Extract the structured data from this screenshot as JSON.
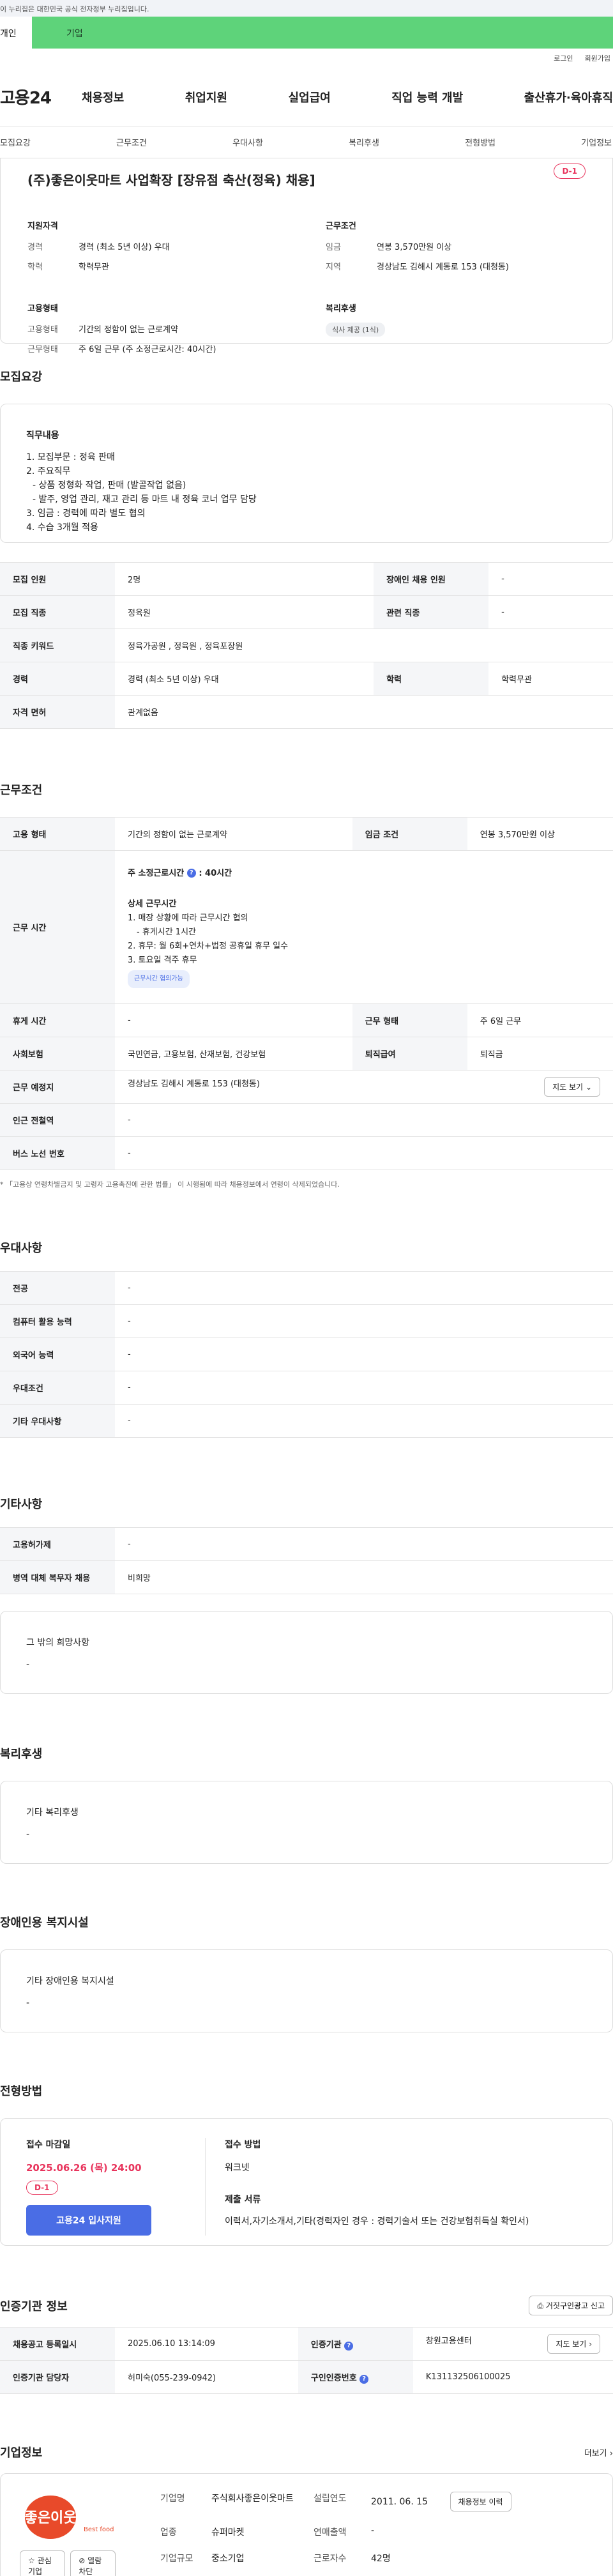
{
  "gov_notice": "이 누리집은 대한민국 공식 전자정부 누리집입니다.",
  "top_tabs": [
    "개인",
    "기업"
  ],
  "utility": [
    "로그인",
    "회원가입"
  ],
  "logo": "고용24",
  "gnb": [
    "채용정보",
    "취업지원",
    "실업급여",
    "직업 능력 개발",
    "출산휴가·육아휴직"
  ],
  "subtabs": [
    "모집요강",
    "근무조건",
    "우대사항",
    "복리후생",
    "전형방법",
    "기업정보"
  ],
  "summary": {
    "title": "(주)좋은이웃마트 사업확장 [장유점 축산(정육) 채용]",
    "dday": "D-1",
    "qual_title": "지원자격",
    "qual": [
      {
        "k": "경력",
        "v": "경력 (최소 5년 이상) 우대"
      },
      {
        "k": "학력",
        "v": "학력무관"
      }
    ],
    "cond_title": "근무조건",
    "cond": [
      {
        "k": "임금",
        "v": "연봉 3,570만원 이상"
      },
      {
        "k": "지역",
        "v": "경상남도 김해시 계동로 153 (대청동)"
      }
    ],
    "emp_title": "고용형태",
    "emp": [
      {
        "k": "고용형태",
        "v": "기간의 정함이 없는 근로계약"
      },
      {
        "k": "근무형태",
        "v": "주 6일 근무 (주 소정근로시간: 40시간)"
      }
    ],
    "welfare_title": "복리후생",
    "welfare_chip": "식사 제공 (1식)"
  },
  "recruit": {
    "title": "모집요강",
    "duty_title": "직무내용",
    "duty_lines": [
      "1. 모집부문 : 정육 판매",
      "2. 주요직무",
      "  - 상품 정형화 작업, 판매 (발골작업 없음)",
      "  - 발주, 영업 관리, 재고 관리 등 마트 내 정육 코너 업무 담당",
      "3. 임금 : 경력에 따라 별도 협의",
      "4. 수습 3개월 적용"
    ],
    "rows": [
      {
        "k1": "모집 인원",
        "v1": "2명",
        "k2": "장애인 채용 인원",
        "v2": "-"
      },
      {
        "k1": "모집 직종",
        "v1": "정육원",
        "k2": "관련 직종",
        "v2": "-"
      },
      {
        "k1": "직종 키워드",
        "v1": "정육가공원 , 정육원 , 정육포장원",
        "k2": "",
        "v2": ""
      },
      {
        "k1": "경력",
        "v1": "경력 (최소 5년 이상) 우대",
        "k2": "학력",
        "v2": "학력무관"
      },
      {
        "k1": "자격 면허",
        "v1": "관계없음",
        "k2": "",
        "v2": ""
      }
    ]
  },
  "workcond": {
    "title": "근무조건",
    "r1": {
      "k1": "고용 형태",
      "v1": "기간의 정함이 없는 근로계약",
      "k2": "임금 조건",
      "v2": "연봉 3,570만원 이상"
    },
    "hours_key": "근무 시간",
    "hours_main": "주 소정근로시간",
    "hours_val": ": 40시간",
    "hours_detail_title": "상세 근무시간",
    "hours_lines": [
      "1. 매장 상황에 따라 근무시간 협의",
      "   - 휴게시간 1시간",
      "2. 휴무: 월 6회+연차+법정 공휴일 휴무 일수",
      "3. 토요일 격주 휴무"
    ],
    "hours_chip": "근무시간 협의가능",
    "r2": {
      "k1": "휴게 시간",
      "v1": "-",
      "k2": "근무 형태",
      "v2": "주 6일 근무"
    },
    "r3": {
      "k1": "사회보험",
      "v1": "국민연금, 고용보험, 산재보험, 건강보험",
      "k2": "퇴직급여",
      "v2": "퇴직금"
    },
    "r4": {
      "k1": "근무 예정지",
      "v1": "경상남도 김해시 계동로 153 (대청동)",
      "btn": "지도 보기"
    },
    "r5": {
      "k1": "인근 전철역",
      "v1": "-"
    },
    "r6": {
      "k1": "버스 노선 번호",
      "v1": "-"
    },
    "notice": "* 「고용상 연령차별금지 및 고령자 고용촉진에 관한 법률」 이 시행됨에 따라 채용정보에서 연령이 삭제되었습니다."
  },
  "pref": {
    "title": "우대사항",
    "rows": [
      {
        "k": "전공",
        "v": "-"
      },
      {
        "k": "컴퓨터 활용 능력",
        "v": "-"
      },
      {
        "k": "외국어 능력",
        "v": "-"
      },
      {
        "k": "우대조건",
        "v": "-"
      },
      {
        "k": "기타 우대사항",
        "v": "-"
      }
    ]
  },
  "etc": {
    "title": "기타사항",
    "rows": [
      {
        "k": "고용허가제",
        "v": "-"
      },
      {
        "k": "병역 대체 복무자 채용",
        "v": "비희망"
      }
    ],
    "box_title": "그 밖의 희망사항",
    "box_val": "-"
  },
  "welfare": {
    "title": "복리후생",
    "box_title": "기타 복리후생",
    "box_val": "-"
  },
  "disabled": {
    "title": "장애인용 복지시설",
    "box_title": "기타 장애인용 복지시설",
    "box_val": "-"
  },
  "selection": {
    "title": "전형방법",
    "deadline_label": "접수 마감일",
    "deadline": "2025.06.26 (목) 24:00",
    "dday": "D-1",
    "apply_btn": "고용24 입사지원",
    "method_label": "접수 방법",
    "method": "워크넷",
    "docs_label": "제출 서류",
    "docs": "이력서,자기소개서,기타(경력자인 경우 : 경력기술서 또는 건강보험취득실 확인서)"
  },
  "cert": {
    "title": "인증기관 정보",
    "report_btn": "거짓구인광고 신고",
    "r1": {
      "k1": "채용공고 등록일시",
      "v1": "2025.06.10 13:14:09",
      "k2": "인증기관",
      "v2": "창원고용센터",
      "btn": "지도 보기"
    },
    "r2": {
      "k1": "인증기관 담당자",
      "v1": "허미숙(055-239-0942)",
      "k2": "구인인증번호",
      "v2": "K131132506100025"
    }
  },
  "company": {
    "title": "기업정보",
    "more": "더보기",
    "logo_text": "좋은이웃",
    "logo_sub": "Best food",
    "fav_btn": "관심기업",
    "block_btn": "열람차단",
    "fields": [
      {
        "k": "기업명",
        "v": "주식회사좋은이웃마트"
      },
      {
        "k": "설립연도",
        "v": "2011. 06. 15"
      },
      {
        "k": "업종",
        "v": "슈퍼마켓"
      },
      {
        "k": "연매출액",
        "v": "-"
      },
      {
        "k": "기업규모",
        "v": "중소기업"
      },
      {
        "k": "근로자수",
        "v": "42명"
      }
    ],
    "history_btn": "채용정보 이력"
  },
  "colors": {
    "accent": "#4a6de5",
    "dday": "#e8345c",
    "green_tab": "#5ed37a"
  }
}
